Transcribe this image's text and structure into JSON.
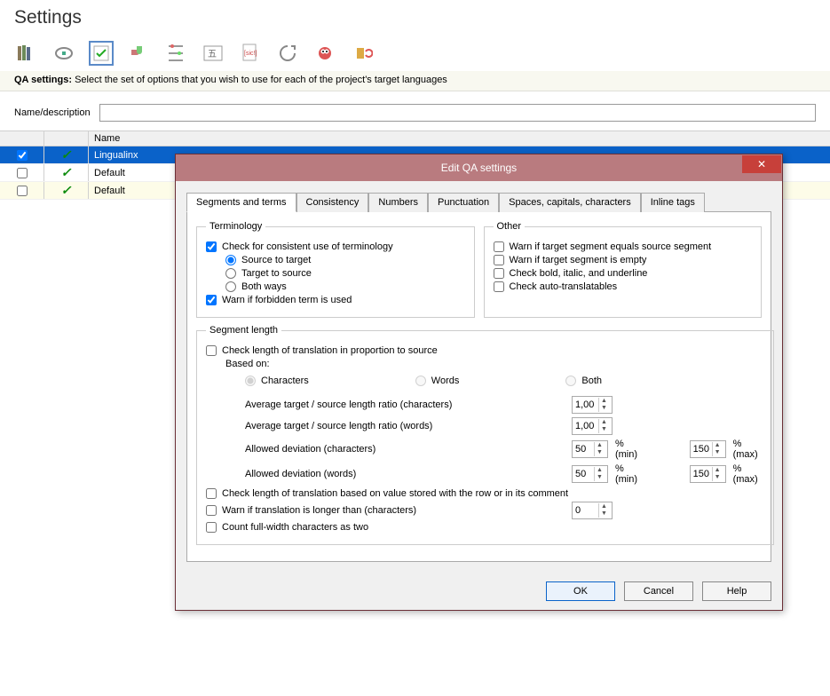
{
  "page": {
    "title": "Settings",
    "qa_label": "QA settings:",
    "qa_desc": "Select the set of options that you wish to use for each of the project's target languages",
    "name_label": "Name/description",
    "name_value": "",
    "grid_header_name": "Name",
    "rows": [
      {
        "checked": true,
        "name": "Lingualinx",
        "selected": true,
        "alt": false
      },
      {
        "checked": false,
        "name": "Default",
        "selected": false,
        "alt": false
      },
      {
        "checked": false,
        "name": "Default",
        "selected": false,
        "alt": true
      }
    ],
    "toolbar_icons": [
      "books-icon",
      "scanner-icon",
      "check-sheet-icon",
      "puzzle-icon",
      "paths-icon",
      "char-table-icon",
      "sic-doc-icon",
      "loop-icon",
      "bug-icon",
      "refresh-icon"
    ]
  },
  "dialog": {
    "title": "Edit QA settings",
    "tabs": [
      "Segments and terms",
      "Consistency",
      "Numbers",
      "Punctuation",
      "Spaces, capitals, characters",
      "Inline tags"
    ],
    "terminology": {
      "legend": "Terminology",
      "consistent": {
        "label": "Check for consistent use of terminology",
        "checked": true
      },
      "source_to_target": "Source to target",
      "target_to_source": "Target to source",
      "both_ways": "Both ways",
      "direction_selected": "source_to_target",
      "forbidden": {
        "label": "Warn if forbidden term is used",
        "checked": true
      }
    },
    "other": {
      "legend": "Other",
      "equals_source": {
        "label": "Warn if target segment equals source segment",
        "checked": false
      },
      "empty": {
        "label": "Warn if target segment is empty",
        "checked": false
      },
      "bold_italic": {
        "label": "Check bold, italic, and underline",
        "checked": false
      },
      "auto_trans": {
        "label": "Check auto-translatables",
        "checked": false
      }
    },
    "seglen": {
      "legend": "Segment length",
      "proportion": {
        "label": "Check length of translation in proportion to source",
        "checked": false
      },
      "based_on": "Based on:",
      "characters": "Characters",
      "words": "Words",
      "both": "Both",
      "basis_selected": "characters",
      "ratio_chars_label": "Average target / source length ratio (characters)",
      "ratio_chars": "1,00",
      "ratio_words_label": "Average target / source length ratio (words)",
      "ratio_words": "1,00",
      "dev_chars_label": "Allowed deviation (characters)",
      "dev_chars_min": "50",
      "dev_chars_max": "150",
      "dev_words_label": "Allowed deviation (words)",
      "dev_words_min": "50",
      "dev_words_max": "150",
      "pct_min": "% (min)",
      "pct_max": "% (max)",
      "stored": {
        "label": "Check length of translation based on value stored with the row or in its comment",
        "checked": false
      },
      "longer": {
        "label": "Warn if translation is longer than (characters)",
        "checked": false,
        "value": "0"
      },
      "fullwidth": {
        "label": "Count full-width characters as two",
        "checked": false
      }
    },
    "buttons": {
      "ok": "OK",
      "cancel": "Cancel",
      "help": "Help"
    }
  }
}
